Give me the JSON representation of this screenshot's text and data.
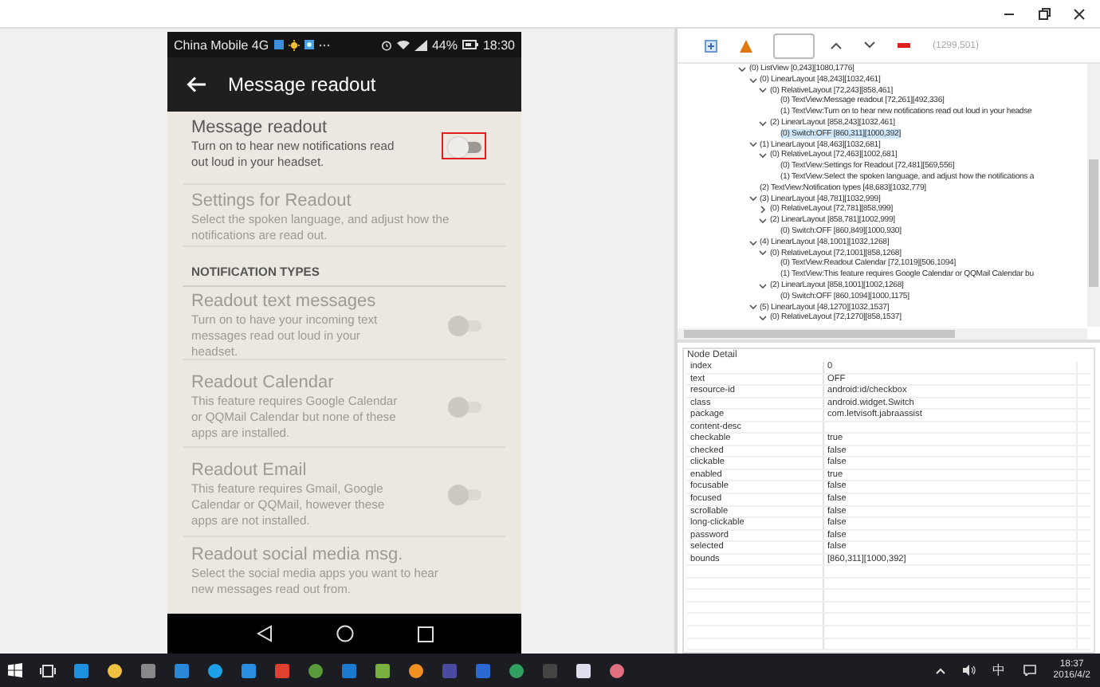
{
  "phone": {
    "status_bar": {
      "carrier": "China Mobile 4G",
      "battery": "44%",
      "time": "18:30"
    },
    "app_bar": {
      "title": "Message readout"
    },
    "items": [
      {
        "kind": "toggle",
        "title": "Message readout",
        "description": "Turn on to hear new notifications read out loud in your headset.",
        "disabled": false,
        "on": false,
        "highlighted": true
      },
      {
        "kind": "link",
        "title": "Settings for Readout",
        "description": "Select the spoken language, and adjust how the notifications are read out.",
        "disabled": true
      },
      {
        "kind": "header",
        "title": "NOTIFICATION TYPES"
      },
      {
        "kind": "toggle",
        "title": "Readout text messages",
        "description": "Turn on to have your incoming text messages read out loud in your headset.",
        "disabled": true,
        "on": false
      },
      {
        "kind": "toggle",
        "title": "Readout Calendar",
        "description": "This feature requires Google Calendar or QQMail Calendar but none of these apps are installed.",
        "disabled": true,
        "on": false
      },
      {
        "kind": "toggle",
        "title": "Readout Email",
        "description": "This feature requires Gmail, Google Calendar or QQMail, however these apps are not installed.",
        "disabled": true,
        "on": false
      },
      {
        "kind": "link",
        "title": "Readout social media msg.",
        "description": "Select the social media apps you want to hear new messages read out from.",
        "disabled": true
      }
    ]
  },
  "toolbar": {
    "coordinates": "(1299,501)"
  },
  "tree": [
    {
      "label": "(0) ListView [0,243][1080,1776]",
      "expanded": true,
      "selected": false,
      "children": [
        {
          "label": "(0) LinearLayout [48,243][1032,461]",
          "expanded": true,
          "selected": false,
          "children": [
            {
              "label": "(0) RelativeLayout [72,243][858,461]",
              "expanded": true,
              "selected": false,
              "children": [
                {
                  "label": "(0) TextView:Message readout [72,261][492,336]",
                  "selected": false
                },
                {
                  "label": "(1) TextView:Turn on to hear new notifications read out loud in your headse",
                  "selected": false
                }
              ]
            },
            {
              "label": "(2) LinearLayout [858,243][1032,461]",
              "expanded": true,
              "selected": false,
              "children": [
                {
                  "label": "(0) Switch:OFF [860,311][1000,392]",
                  "selected": true
                }
              ]
            }
          ]
        },
        {
          "label": "(1) LinearLayout [48,463][1032,681]",
          "expanded": true,
          "selected": false,
          "children": [
            {
              "label": "(0) RelativeLayout [72,463][1002,681]",
              "expanded": true,
              "selected": false,
              "children": [
                {
                  "label": "(0) TextView:Settings for Readout [72,481][569,556]",
                  "selected": false
                },
                {
                  "label": "(1) TextView:Select the spoken language, and adjust how the notifications a",
                  "selected": false
                }
              ]
            }
          ]
        },
        {
          "label": "(2) TextView:Notification types [48,683][1032,779]",
          "selected": false
        },
        {
          "label": "(3) LinearLayout [48,781][1032,999]",
          "expanded": true,
          "selected": false,
          "children": [
            {
              "label": "(0) RelativeLayout [72,781][858,999]",
              "expanded": false,
              "selected": false
            },
            {
              "label": "(2) LinearLayout [858,781][1002,999]",
              "expanded": true,
              "selected": false,
              "children": [
                {
                  "label": "(0) Switch:OFF [860,849][1000,930]",
                  "selected": false
                }
              ]
            }
          ]
        },
        {
          "label": "(4) LinearLayout [48,1001][1032,1268]",
          "expanded": true,
          "selected": false,
          "children": [
            {
              "label": "(0) RelativeLayout [72,1001][858,1268]",
              "expanded": true,
              "selected": false,
              "children": [
                {
                  "label": "(0) TextView:Readout Calendar [72,1019][506,1094]",
                  "selected": false
                },
                {
                  "label": "(1) TextView:This feature requires Google Calendar or QQMail Calendar bu",
                  "selected": false
                }
              ]
            },
            {
              "label": "(2) LinearLayout [858,1001][1002,1268]",
              "expanded": true,
              "selected": false,
              "children": [
                {
                  "label": "(0) Switch:OFF [860,1094][1000,1175]",
                  "selected": false
                }
              ]
            }
          ]
        },
        {
          "label": "(5) LinearLayout [48,1270][1032,1537]",
          "expanded": true,
          "selected": false,
          "children": [
            {
              "label": "(0) RelativeLayout [72,1270][858,1537]",
              "expanded": true,
              "selected": false
            }
          ]
        }
      ]
    }
  ],
  "node_detail": {
    "title": "Node Detail",
    "rows": [
      {
        "key": "index",
        "value": "0"
      },
      {
        "key": "text",
        "value": "OFF"
      },
      {
        "key": "resource-id",
        "value": "android:id/checkbox"
      },
      {
        "key": "class",
        "value": "android.widget.Switch"
      },
      {
        "key": "package",
        "value": "com.letvisoft.jabraassist"
      },
      {
        "key": "content-desc"
      },
      {
        "key": "checkable",
        "value": "true"
      },
      {
        "key": "checked",
        "value": "false"
      },
      {
        "key": "clickable",
        "value": "false"
      },
      {
        "key": "enabled",
        "value": "true"
      },
      {
        "key": "focusable",
        "value": "false"
      },
      {
        "key": "focused",
        "value": "false"
      },
      {
        "key": "scrollable",
        "value": "false"
      },
      {
        "key": "long-clickable",
        "value": "false"
      },
      {
        "key": "password",
        "value": "false"
      },
      {
        "key": "selected",
        "value": "false"
      },
      {
        "key": "bounds",
        "value": "[860,311][1000,392]"
      }
    ]
  },
  "taskbar": {
    "ime": "中",
    "time": "18:37",
    "date": "2016/4/2"
  }
}
